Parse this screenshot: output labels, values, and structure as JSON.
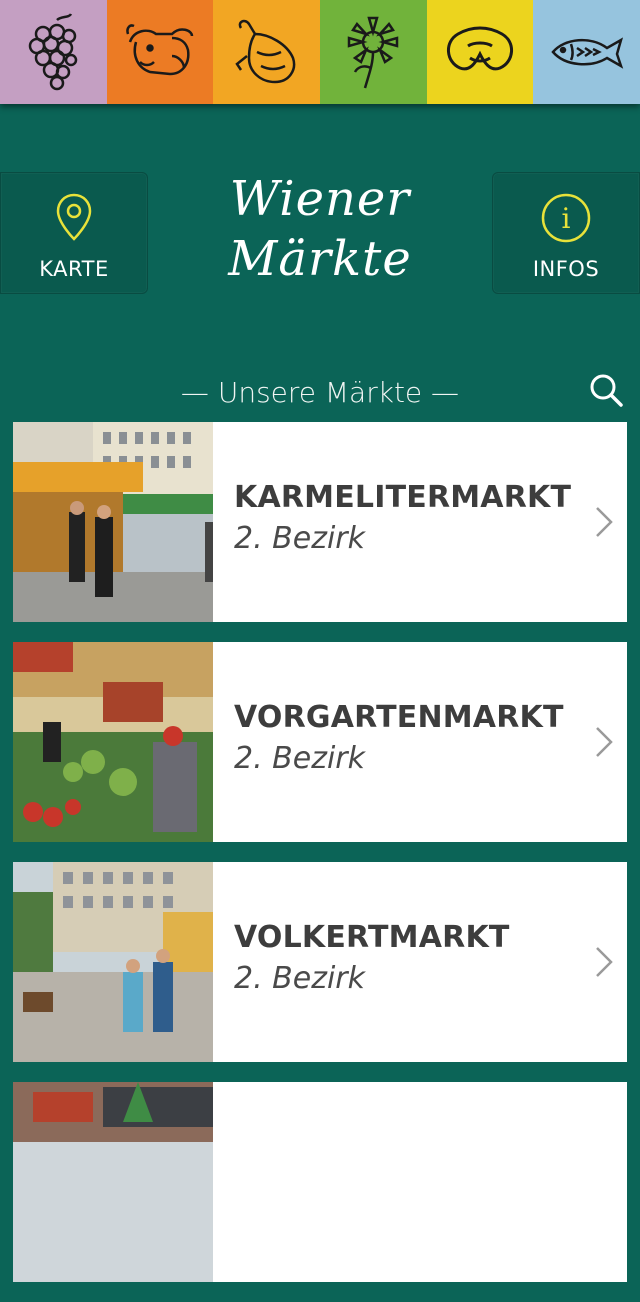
{
  "banner": {
    "strips": [
      {
        "color": "#c49fc2",
        "icon": "grapes-icon"
      },
      {
        "color": "#ec7b24",
        "icon": "cow-icon"
      },
      {
        "color": "#f2a623",
        "icon": "chicken-icon"
      },
      {
        "color": "#71b33b",
        "icon": "sunflower-icon"
      },
      {
        "color": "#ecd41e",
        "icon": "pretzel-icon"
      },
      {
        "color": "#96c4de",
        "icon": "fish-icon"
      }
    ]
  },
  "header": {
    "map_button": {
      "label": "KARTE",
      "icon": "map-pin-icon"
    },
    "info_button": {
      "label": "INFOS",
      "icon": "info-icon"
    },
    "logo_line1": "Wiener",
    "logo_line2": "Märkte"
  },
  "section": {
    "title": "— Unsere Märkte —",
    "search_icon": "search-icon"
  },
  "colors": {
    "background": "#0b6457",
    "accent_yellow": "#e8e23a",
    "card_text": "#3d3d3d"
  },
  "markets": [
    {
      "name": "KARMELITERMARKT",
      "district": "2. Bezirk"
    },
    {
      "name": "VORGARTENMARKT",
      "district": "2. Bezirk"
    },
    {
      "name": "VOLKERTMARKT",
      "district": "2. Bezirk"
    },
    {
      "name": "",
      "district": ""
    }
  ]
}
